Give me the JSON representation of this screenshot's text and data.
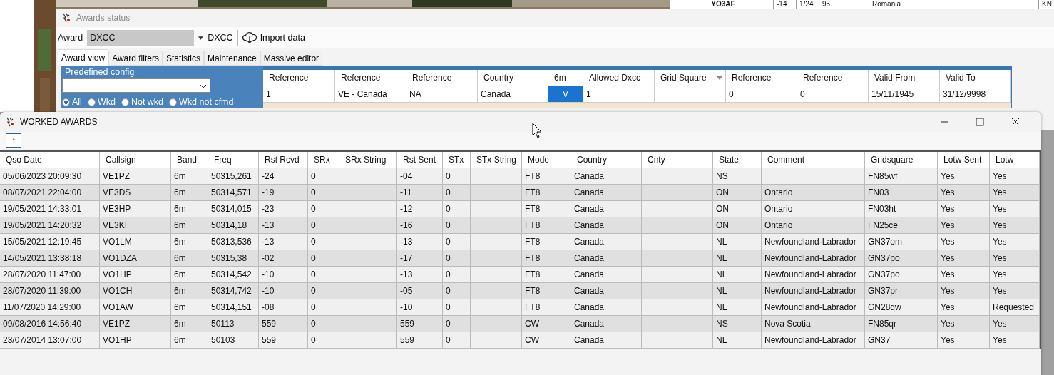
{
  "background_table": {
    "cells": [
      "YO3AF",
      "-14",
      "1/24",
      "95",
      "Romania",
      "KN"
    ]
  },
  "awards_window": {
    "title": "Awards status",
    "award_label": "Award",
    "award_value": "DXCC",
    "award_name": "DXCC",
    "import_button": "Import data",
    "tabs": [
      {
        "label": "Award view",
        "selected": true
      },
      {
        "label": "Award filters",
        "selected": false
      },
      {
        "label": "Statistics",
        "selected": false
      },
      {
        "label": "Maintenance",
        "selected": false
      },
      {
        "label": "Massive editor",
        "selected": false
      }
    ],
    "predefined_config": {
      "label": "Predefined config"
    },
    "filters": [
      {
        "label": "All",
        "selected": true
      },
      {
        "label": "Wkd",
        "selected": false
      },
      {
        "label": "Not wkd",
        "selected": false
      },
      {
        "label": "Wkd not cfmd",
        "selected": false
      }
    ],
    "grid": {
      "columns": [
        "Reference",
        "Reference",
        "Reference",
        "Country",
        "6m",
        "Allowed Dxcc",
        "Grid Square",
        "Reference",
        "Reference",
        "Valid From",
        "Valid To"
      ],
      "rows": [
        {
          "cells": [
            "1",
            "VE - Canada",
            "NA",
            "Canada",
            "V",
            "1",
            "",
            "0",
            "0",
            "15/11/1945",
            "31/12/9998"
          ]
        }
      ]
    }
  },
  "worked_window": {
    "title": "WORKED AWARDS",
    "toolbar_button": "↑",
    "table": {
      "columns": [
        "Qso Date",
        "Callsign",
        "Band",
        "Freq",
        "Rst Rcvd",
        "SRx",
        "SRx String",
        "Rst Sent",
        "STx",
        "STx String",
        "Mode",
        "Country",
        "Cnty",
        "State",
        "Comment",
        "Gridsquare",
        "Lotw Sent",
        "Lotw"
      ],
      "rows": [
        [
          "05/06/2023 20:09:30",
          "VE1PZ",
          "6m",
          "50315,261",
          "-24",
          "0",
          "",
          "-04",
          "0",
          "",
          "FT8",
          "Canada",
          "",
          "NS",
          "",
          "FN85wf",
          "Yes",
          "Yes"
        ],
        [
          "08/07/2021 22:04:00",
          "VE3DS",
          "6m",
          "50314,571",
          "-19",
          "0",
          "",
          "-11",
          "0",
          "",
          "FT8",
          "Canada",
          "",
          "ON",
          "Ontario",
          "FN03",
          "Yes",
          "Yes"
        ],
        [
          "19/05/2021 14:33:01",
          "VE3HP",
          "6m",
          "50314,015",
          "-23",
          "0",
          "",
          "-12",
          "0",
          "",
          "FT8",
          "Canada",
          "",
          "ON",
          "Ontario",
          "FN03ht",
          "Yes",
          "Yes"
        ],
        [
          "19/05/2021 14:20:32",
          "VE3KI",
          "6m",
          "50314,18",
          "-13",
          "0",
          "",
          "-16",
          "0",
          "",
          "FT8",
          "Canada",
          "",
          "ON",
          "Ontario",
          "FN25ce",
          "Yes",
          "Yes"
        ],
        [
          "15/05/2021 12:19:45",
          "VO1LM",
          "6m",
          "50313,536",
          "-13",
          "0",
          "",
          "-13",
          "0",
          "",
          "FT8",
          "Canada",
          "",
          "NL",
          "Newfoundland-Labrador",
          "GN37om",
          "Yes",
          "Yes"
        ],
        [
          "14/05/2021 13:38:18",
          "VO1DZA",
          "6m",
          "50315,38",
          "-02",
          "0",
          "",
          "-17",
          "0",
          "",
          "FT8",
          "Canada",
          "",
          "NL",
          "Newfoundland-Labrador",
          "GN37po",
          "Yes",
          "Yes"
        ],
        [
          "28/07/2020 11:47:00",
          "VO1HP",
          "6m",
          "50314,542",
          "-10",
          "0",
          "",
          "-13",
          "0",
          "",
          "FT8",
          "Canada",
          "",
          "NL",
          "Newfoundland-Labrador",
          "GN37po",
          "Yes",
          "Yes"
        ],
        [
          "28/07/2020 11:39:00",
          "VO1CH",
          "6m",
          "50314,742",
          "-10",
          "0",
          "",
          "-05",
          "0",
          "",
          "FT8",
          "Canada",
          "",
          "NL",
          "Newfoundland-Labrador",
          "GN37pr",
          "Yes",
          "Yes"
        ],
        [
          "11/07/2020 14:29:00",
          "VO1AW",
          "6m",
          "50314,151",
          "-08",
          "0",
          "",
          "-10",
          "0",
          "",
          "FT8",
          "Canada",
          "",
          "NL",
          "Newfoundland-Labrador",
          "GN28qw",
          "Yes",
          "Requested"
        ],
        [
          "09/08/2016 14:56:40",
          "VE1PZ",
          "6m",
          "50113",
          "559",
          "0",
          "",
          "559",
          "0",
          "",
          "CW",
          "Canada",
          "",
          "NS",
          "Nova Scotia",
          "FN85qr",
          "Yes",
          "Yes"
        ],
        [
          "23/07/2014 13:07:00",
          "VO1HP",
          "6m",
          "50103",
          "559",
          "0",
          "",
          "559",
          "0",
          "",
          "CW",
          "Canada",
          "",
          "NL",
          "Newfoundland-Labrador",
          "GN37",
          "Yes",
          "Yes"
        ]
      ]
    }
  }
}
